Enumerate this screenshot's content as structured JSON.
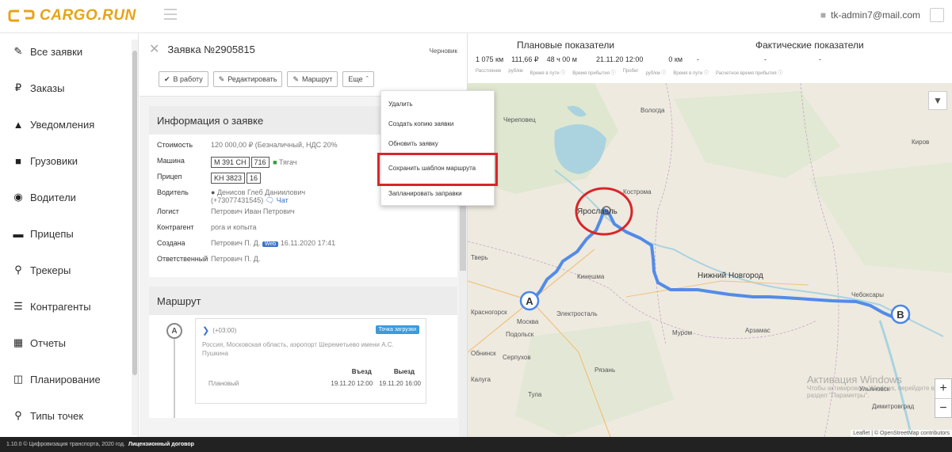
{
  "app": {
    "logo_text": "CARGO.RUN",
    "user_email": "tk-admin7@mail.com",
    "brand_color": "#e8a317"
  },
  "sidebar": {
    "items": [
      {
        "label": "Все заявки",
        "icon": "edit-icon"
      },
      {
        "label": "Заказы",
        "icon": "ruble-icon"
      },
      {
        "label": "Уведомления",
        "icon": "bell-icon"
      },
      {
        "label": "Грузовики",
        "icon": "truck-icon"
      },
      {
        "label": "Водители",
        "icon": "steering-wheel-icon"
      },
      {
        "label": "Прицепы",
        "icon": "trailer-icon"
      },
      {
        "label": "Трекеры",
        "icon": "location-pin-icon"
      },
      {
        "label": "Контрагенты",
        "icon": "contacts-icon"
      },
      {
        "label": "Отчеты",
        "icon": "report-icon"
      },
      {
        "label": "Планирование",
        "icon": "calendar-icon"
      },
      {
        "label": "Типы точек",
        "icon": "location-pin-icon"
      }
    ]
  },
  "order": {
    "title": "Заявка №2905815",
    "status": "Черновик",
    "toolbar": {
      "to_work": "В работу",
      "edit": "Редактировать",
      "route": "Маршрут",
      "more": "Еще"
    },
    "info_title": "Информация о заявке",
    "info": {
      "cost_label": "Стоимость",
      "cost_value": "120 000,00 ₽ (Безналичный, НДС 20%",
      "vehicle_label": "Машина",
      "vehicle_plate": "M 391 CH",
      "vehicle_region": "716",
      "vehicle_type": "Тягач",
      "trailer_label": "Прицеп",
      "trailer_plate": "KH 3823",
      "trailer_region": "16",
      "driver_label": "Водитель",
      "driver_name": "Денисов Глеб Даниилович",
      "driver_phone": "(+73077431545)",
      "driver_chat": "Чат",
      "logist_label": "Логист",
      "logist_value": "Петрович Иван Петрович",
      "counterparty_label": "Контрагент",
      "counterparty_value": "рога и копыта",
      "created_label": "Создана",
      "created_by": "Петрович П. Д.",
      "created_source": "Web",
      "created_at": "16.11.2020 17:41",
      "responsible_label": "Ответственный",
      "responsible_value": "Петрович П. Д."
    },
    "route_title": "Маршрут",
    "route_point": {
      "letter": "A",
      "time": "(+03:00)",
      "badge": "Точка загрузки",
      "address": "Россия, Московская область, аэропорт Шереметьево имени А.С. Пушкина",
      "col_entry": "Въезд",
      "col_exit": "Выезд",
      "row_label": "Плановый",
      "entry": "19.11.20 12:00",
      "exit": "19.11.20 16:00"
    }
  },
  "dropdown": {
    "items": [
      "Удалить",
      "Создать копию заявки",
      "Обновить заявку",
      "Сохранить шаблон маршрута",
      "Запланировать заправки"
    ]
  },
  "stats": {
    "planned_title": "Плановые показатели",
    "actual_title": "Фактические показатели",
    "planned_values": [
      "1 075 км",
      "111,66 ₽",
      "48 ч 00 м",
      "21.11.20 12:00"
    ],
    "actual_values": [
      "0 км",
      "-",
      "-",
      "-"
    ],
    "labels": [
      "Расстояние",
      "руб/км",
      "Время в пути ⓘ",
      "Время прибытия ⓘ",
      "Пробег",
      "руб/км ⓘ",
      "Время в пути ⓘ",
      "Расчетное время прибытия ⓘ"
    ]
  },
  "map": {
    "labels": {
      "vologda": "Вологда",
      "cherepovets": "Череповец",
      "kirov": "Киров",
      "kostroma": "Кострома",
      "yaroslavl": "Ярославль",
      "tver": "Тверь",
      "nizhny": "Нижний Новгород",
      "moscow": "Москва",
      "krasnogorsk": "Красногорск",
      "elektrostal": "Электросталь",
      "murom": "Муром",
      "arzamas": "Арзамас",
      "ryazan": "Рязань",
      "tula": "Тула",
      "kaluga": "Калуга",
      "obninsk": "Обнинск",
      "cheboksary": "Чебоксары",
      "ulyanovsk": "Ульяновск",
      "kineshma": "Кинешма",
      "sergiev": "Сергиев Посад",
      "podolsk": "Подольск",
      "serpukhov": "Серпухов",
      "dimitrovgrad": "Димитровград"
    },
    "marker_a": "A",
    "marker_b": "B",
    "zoom_in": "+",
    "zoom_out": "−",
    "attribution": "Leaflet | © OpenStreetMap contributors",
    "watermark_title": "Активация Windows",
    "watermark_sub": "Чтобы активировать Windows, перейдите в раздел \"Параметры\".",
    "route_color": "#4a86e8",
    "highlight_color": "#d7262a"
  },
  "footer": {
    "text": "1.10.0 © Цифровизация транспорта, 2020 год.",
    "license": "Лицензионный договор"
  }
}
